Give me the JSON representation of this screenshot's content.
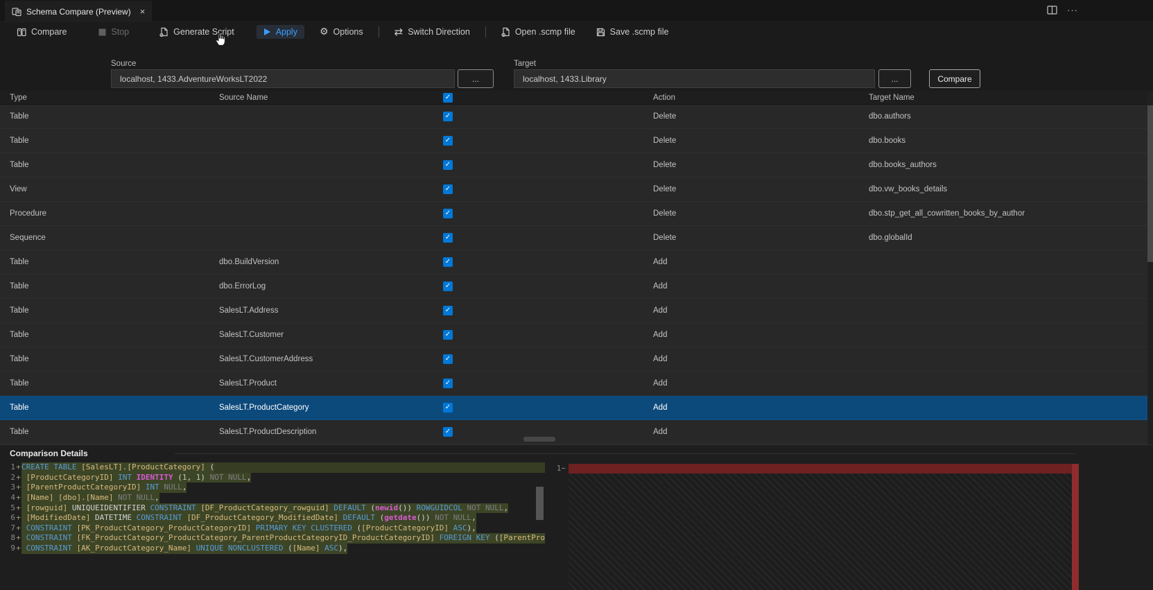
{
  "tab": {
    "title": "Schema Compare (Preview)",
    "close": "×"
  },
  "window_controls": {
    "more": "···"
  },
  "toolbar": {
    "compare": "Compare",
    "stop": "Stop",
    "generate_script": "Generate Script",
    "apply": "Apply",
    "options": "Options",
    "options_icon": "⚙",
    "switch_direction": "Switch Direction",
    "switch_icon": "⇄",
    "open_scmp": "Open .scmp file",
    "save_scmp": "Save .scmp file"
  },
  "connections": {
    "source_label": "Source",
    "source_value": "localhost, 1433.AdventureWorksLT2022",
    "target_label": "Target",
    "target_value": "localhost, 1433.Library",
    "browse": "...",
    "compare_button": "Compare"
  },
  "grid": {
    "columns": {
      "type": "Type",
      "source_name": "Source Name",
      "action": "Action",
      "target_name": "Target Name"
    },
    "header_checked": true,
    "check_glyph": "✓",
    "rows": [
      {
        "type": "Table",
        "source_name": "",
        "checked": true,
        "action": "Delete",
        "target_name": "dbo.authors",
        "selected": false
      },
      {
        "type": "Table",
        "source_name": "",
        "checked": true,
        "action": "Delete",
        "target_name": "dbo.books",
        "selected": false
      },
      {
        "type": "Table",
        "source_name": "",
        "checked": true,
        "action": "Delete",
        "target_name": "dbo.books_authors",
        "selected": false
      },
      {
        "type": "View",
        "source_name": "",
        "checked": true,
        "action": "Delete",
        "target_name": "dbo.vw_books_details",
        "selected": false
      },
      {
        "type": "Procedure",
        "source_name": "",
        "checked": true,
        "action": "Delete",
        "target_name": "dbo.stp_get_all_cowritten_books_by_author",
        "selected": false
      },
      {
        "type": "Sequence",
        "source_name": "",
        "checked": true,
        "action": "Delete",
        "target_name": "dbo.globalId",
        "selected": false
      },
      {
        "type": "Table",
        "source_name": "dbo.BuildVersion",
        "checked": true,
        "action": "Add",
        "target_name": "",
        "selected": false
      },
      {
        "type": "Table",
        "source_name": "dbo.ErrorLog",
        "checked": true,
        "action": "Add",
        "target_name": "",
        "selected": false
      },
      {
        "type": "Table",
        "source_name": "SalesLT.Address",
        "checked": true,
        "action": "Add",
        "target_name": "",
        "selected": false
      },
      {
        "type": "Table",
        "source_name": "SalesLT.Customer",
        "checked": true,
        "action": "Add",
        "target_name": "",
        "selected": false
      },
      {
        "type": "Table",
        "source_name": "SalesLT.CustomerAddress",
        "checked": true,
        "action": "Add",
        "target_name": "",
        "selected": false
      },
      {
        "type": "Table",
        "source_name": "SalesLT.Product",
        "checked": true,
        "action": "Add",
        "target_name": "",
        "selected": false
      },
      {
        "type": "Table",
        "source_name": "SalesLT.ProductCategory",
        "checked": true,
        "action": "Add",
        "target_name": "",
        "selected": true
      },
      {
        "type": "Table",
        "source_name": "SalesLT.ProductDescription",
        "checked": true,
        "action": "Add",
        "target_name": "",
        "selected": false
      }
    ]
  },
  "details": {
    "title": "Comparison Details",
    "left_lines": [
      {
        "num": "1",
        "sign": "+",
        "full": true,
        "segments": [
          [
            "kw",
            "CREATE TABLE "
          ],
          [
            "id",
            "[SalesLT].[ProductCategory]"
          ],
          [
            "def",
            " ("
          ]
        ]
      },
      {
        "num": "2",
        "sign": "+",
        "full": false,
        "segments": [
          [
            "def",
            " "
          ],
          [
            "id",
            "[ProductCategoryID]"
          ],
          [
            "def",
            " "
          ],
          [
            "kw",
            "INT"
          ],
          [
            "def",
            " "
          ],
          [
            "fn",
            "IDENTITY"
          ],
          [
            "def",
            " ("
          ],
          [
            "num",
            "1"
          ],
          [
            "def",
            ", "
          ],
          [
            "num",
            "1"
          ],
          [
            "def",
            ") "
          ],
          [
            "gray",
            "NOT NULL"
          ],
          [
            "def",
            ","
          ]
        ]
      },
      {
        "num": "3",
        "sign": "+",
        "full": false,
        "segments": [
          [
            "def",
            " "
          ],
          [
            "id",
            "[ParentProductCategoryID]"
          ],
          [
            "def",
            " "
          ],
          [
            "kw",
            "INT"
          ],
          [
            "def",
            " "
          ],
          [
            "gray",
            "NULL"
          ],
          [
            "def",
            ","
          ]
        ]
      },
      {
        "num": "4",
        "sign": "+",
        "full": false,
        "segments": [
          [
            "def",
            " "
          ],
          [
            "id",
            "[Name]"
          ],
          [
            "def",
            " "
          ],
          [
            "id",
            "[dbo].[Name]"
          ],
          [
            "def",
            " "
          ],
          [
            "gray",
            "NOT NULL"
          ],
          [
            "def",
            ","
          ]
        ]
      },
      {
        "num": "5",
        "sign": "+",
        "full": false,
        "segments": [
          [
            "def",
            " "
          ],
          [
            "id",
            "[rowguid]"
          ],
          [
            "def",
            " UNIQUEIDENTIFIER "
          ],
          [
            "kw",
            "CONSTRAINT"
          ],
          [
            "def",
            " "
          ],
          [
            "id",
            "[DF_ProductCategory_rowguid]"
          ],
          [
            "def",
            " "
          ],
          [
            "kw",
            "DEFAULT"
          ],
          [
            "def",
            " ("
          ],
          [
            "fn",
            "newid"
          ],
          [
            "def",
            "()) "
          ],
          [
            "kw",
            "ROWGUIDCOL"
          ],
          [
            "def",
            " "
          ],
          [
            "gray",
            "NOT NULL"
          ],
          [
            "def",
            ","
          ]
        ]
      },
      {
        "num": "6",
        "sign": "+",
        "full": false,
        "segments": [
          [
            "def",
            " "
          ],
          [
            "id",
            "[ModifiedDate]"
          ],
          [
            "def",
            " DATETIME "
          ],
          [
            "kw",
            "CONSTRAINT"
          ],
          [
            "def",
            " "
          ],
          [
            "id",
            "[DF_ProductCategory_ModifiedDate]"
          ],
          [
            "def",
            " "
          ],
          [
            "kw",
            "DEFAULT"
          ],
          [
            "def",
            " ("
          ],
          [
            "fn",
            "getdate"
          ],
          [
            "def",
            "()) "
          ],
          [
            "gray",
            "NOT NULL"
          ],
          [
            "def",
            ","
          ]
        ]
      },
      {
        "num": "7",
        "sign": "+",
        "full": false,
        "segments": [
          [
            "def",
            " "
          ],
          [
            "kw",
            "CONSTRAINT"
          ],
          [
            "def",
            " "
          ],
          [
            "id",
            "[PK_ProductCategory_ProductCategoryID]"
          ],
          [
            "def",
            " "
          ],
          [
            "kw",
            "PRIMARY KEY CLUSTERED"
          ],
          [
            "def",
            " ("
          ],
          [
            "id",
            "[ProductCategoryID]"
          ],
          [
            "def",
            " "
          ],
          [
            "kw",
            "ASC"
          ],
          [
            "def",
            "),"
          ]
        ]
      },
      {
        "num": "8",
        "sign": "+",
        "full": false,
        "segments": [
          [
            "def",
            " "
          ],
          [
            "kw",
            "CONSTRAINT"
          ],
          [
            "def",
            " "
          ],
          [
            "id",
            "[FK_ProductCategory_ProductCategory_ParentProductCategoryID_ProductCategoryID]"
          ],
          [
            "def",
            " "
          ],
          [
            "kw",
            "FOREIGN KEY"
          ],
          [
            "def",
            " ("
          ],
          [
            "id",
            "[ParentProductCatego"
          ]
        ]
      },
      {
        "num": "9",
        "sign": "+",
        "full": false,
        "segments": [
          [
            "def",
            " "
          ],
          [
            "kw",
            "CONSTRAINT"
          ],
          [
            "def",
            " "
          ],
          [
            "id",
            "[AK_ProductCategory_Name]"
          ],
          [
            "def",
            " "
          ],
          [
            "kw",
            "UNIQUE NONCLUSTERED"
          ],
          [
            "def",
            " ("
          ],
          [
            "id",
            "[Name]"
          ],
          [
            "def",
            " "
          ],
          [
            "kw",
            "ASC"
          ],
          [
            "def",
            "),"
          ]
        ]
      }
    ],
    "right": {
      "num": "1",
      "sign": "−"
    }
  },
  "colors": {
    "checkbox_blue": "#0078d7",
    "selection_blue": "#0d4a7c",
    "apply_blue": "#3b9eff",
    "diff_add_line_bg": "#363d23",
    "diff_add_text_bg": "#3d4527",
    "diff_delete_bar": "#6d2121",
    "overview_delete": "#8f2d2d"
  }
}
